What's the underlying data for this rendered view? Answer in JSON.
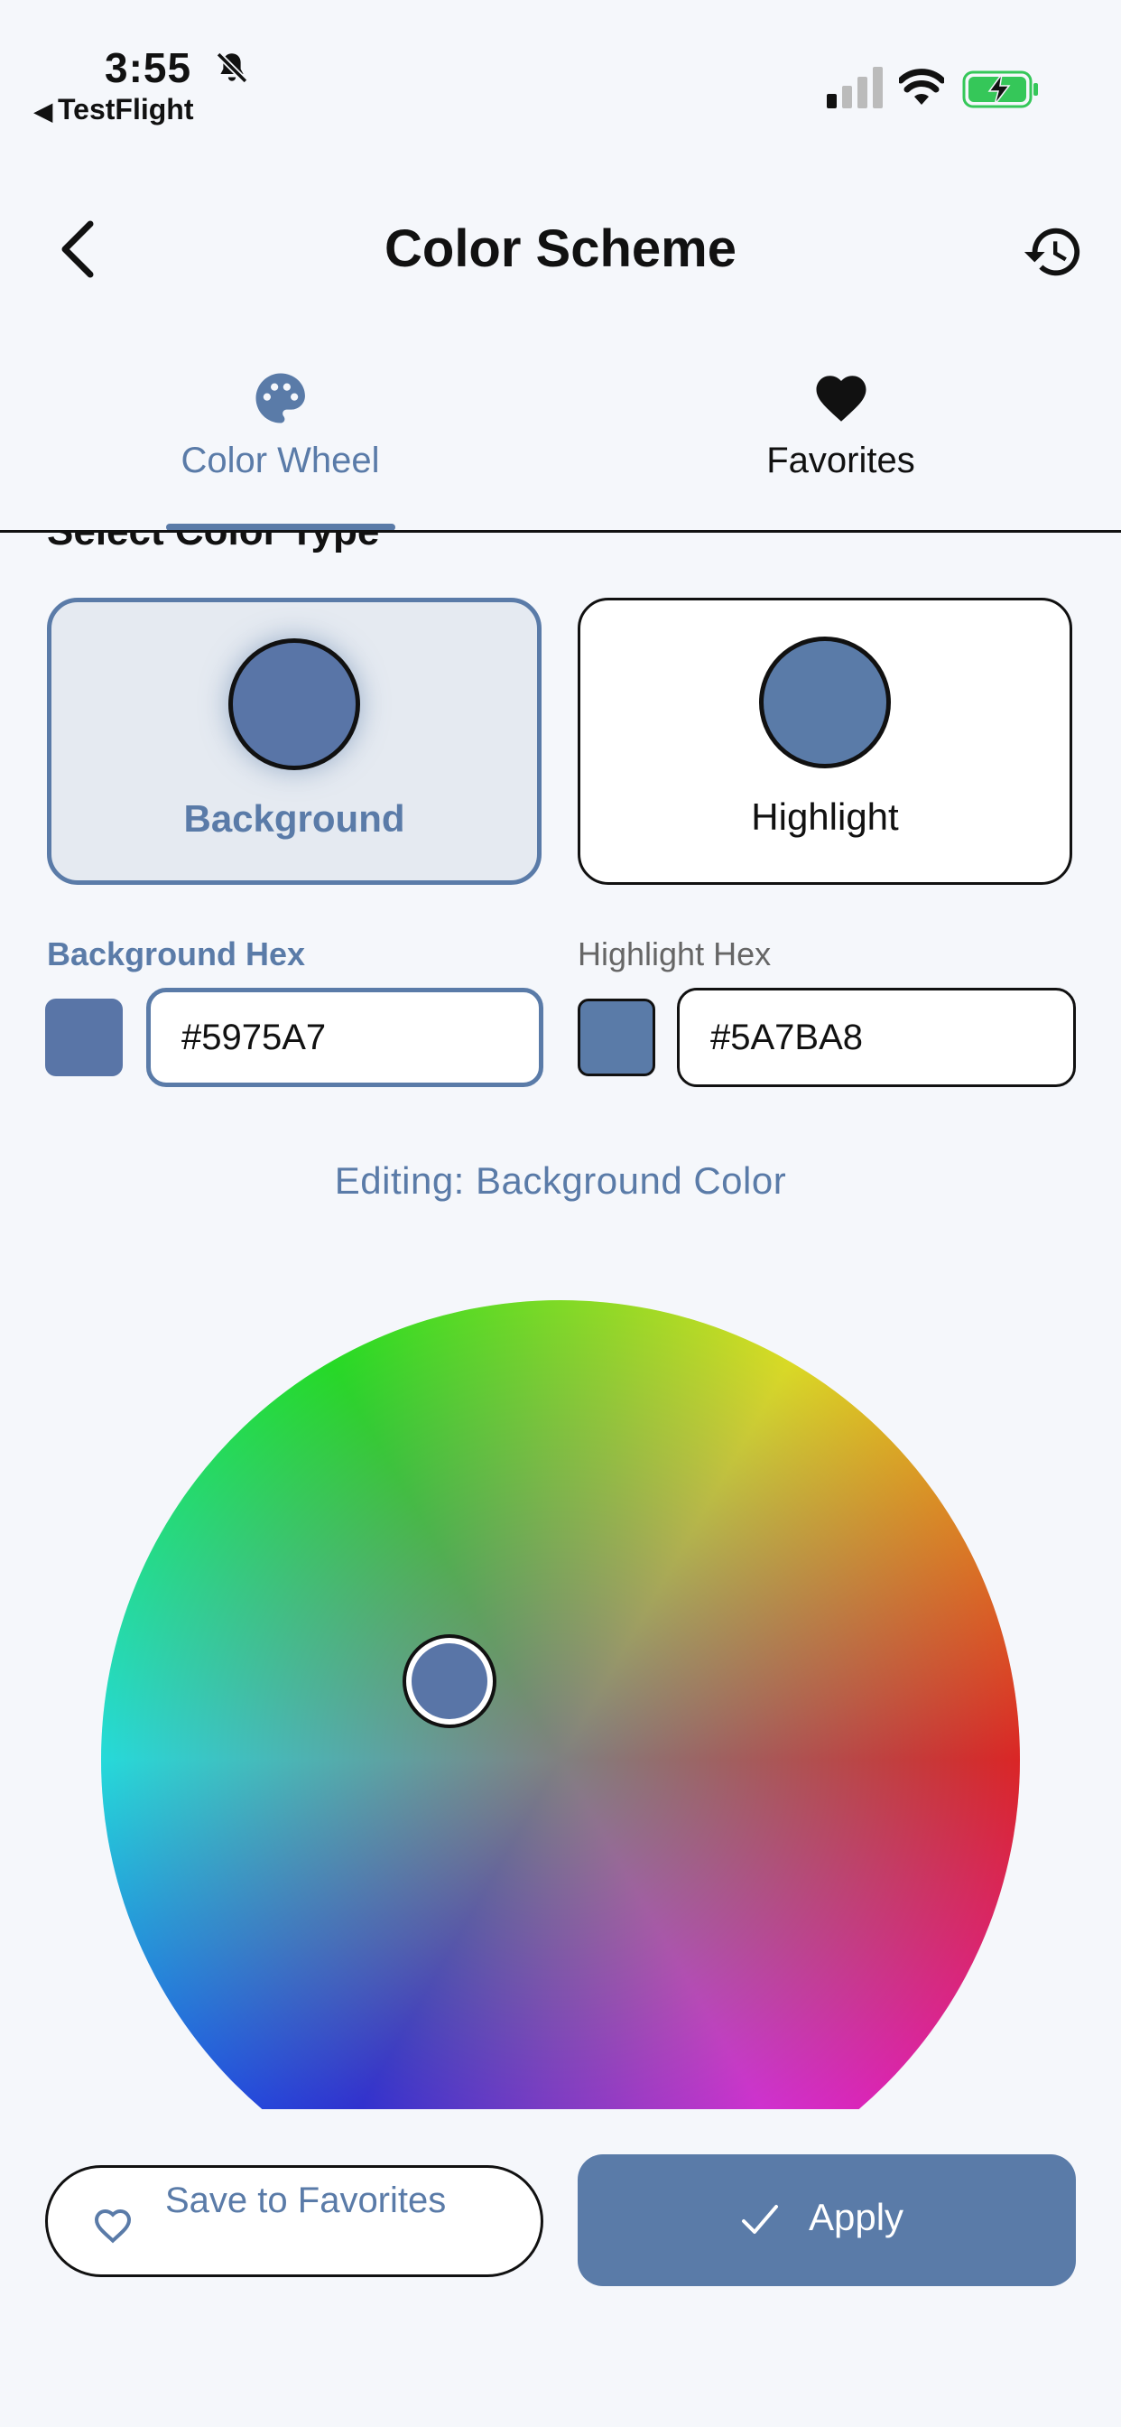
{
  "status_bar": {
    "time": "3:55",
    "back_app": "TestFlight",
    "back_glyph": "◀"
  },
  "header": {
    "title": "Color Scheme"
  },
  "tabs": [
    {
      "label": "Color Wheel",
      "icon": "palette-icon",
      "active": true
    },
    {
      "label": "Favorites",
      "icon": "heart-icon",
      "active": false
    }
  ],
  "section": {
    "heading": "Select Color Type"
  },
  "color_types": {
    "background": {
      "label": "Background",
      "color": "#5975A7",
      "selected": true
    },
    "highlight": {
      "label": "Highlight",
      "color": "#5A7BA8",
      "selected": false
    }
  },
  "hex": {
    "background_label": "Background Hex",
    "background_value": "#5975A7",
    "highlight_label": "Highlight Hex",
    "highlight_value": "#5A7BA8"
  },
  "editing_text": "Editing: Background Color",
  "actions": {
    "save_label": "Save to Favorites",
    "apply_label": "Apply"
  },
  "colors": {
    "accent": "#5A7BA8",
    "background": "#F5F7FB",
    "selected_card": "#E5EAF1",
    "battery_green": "#35C759"
  }
}
